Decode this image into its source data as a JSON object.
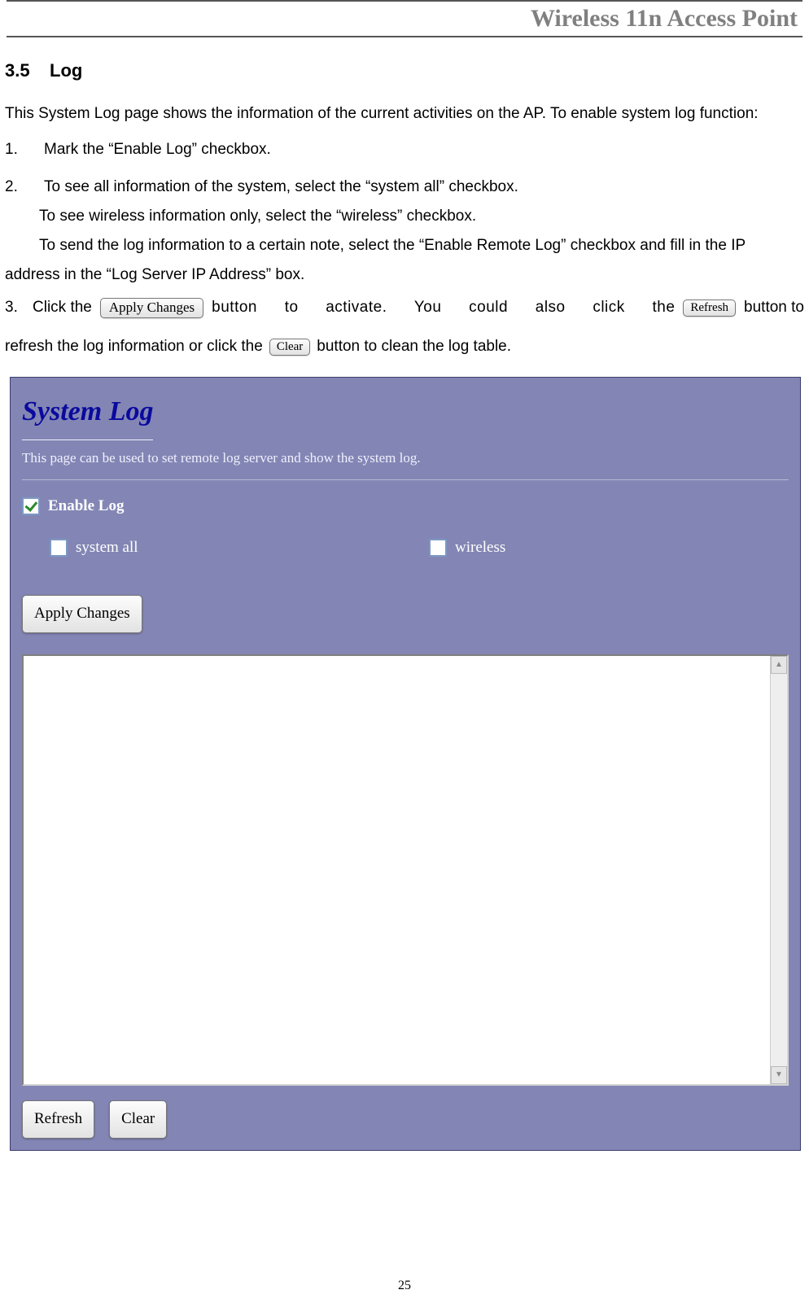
{
  "header": {
    "title": "Wireless 11n Access Point"
  },
  "section": {
    "number": "3.5",
    "title": "Log"
  },
  "intro": "This System Log page shows the information of the current activities on the AP. To enable system log function:",
  "steps": {
    "one": {
      "num": "1.",
      "text": "Mark the “Enable Log” checkbox."
    },
    "two": {
      "num": "2.",
      "line1": "To see all information of the system, select the “system all” checkbox.",
      "line2": "To see wireless information only, select the “wireless” checkbox.",
      "line3": "To send the log information to a certain note, select the “Enable Remote Log” checkbox and fill in the IP address in the “Log Server IP Address” box."
    },
    "three": {
      "num": "3.",
      "pre": "Click  the",
      "mid": "button  to  activate.  You  could  also  click  the",
      "post": "button  to",
      "line2a": "refresh the log information or click the",
      "line2b": "button to clean the log table."
    }
  },
  "buttons": {
    "apply": "Apply Changes",
    "refresh": "Refresh",
    "clear": "Clear"
  },
  "panel": {
    "title": "System Log",
    "subtitle": "This page can be used to set remote log server and show the system log.",
    "enable_label": "Enable Log",
    "systemall_label": "system all",
    "wireless_label": "wireless",
    "apply": "Apply Changes",
    "refresh": "Refresh",
    "clear": "Clear"
  },
  "page_number": "25"
}
